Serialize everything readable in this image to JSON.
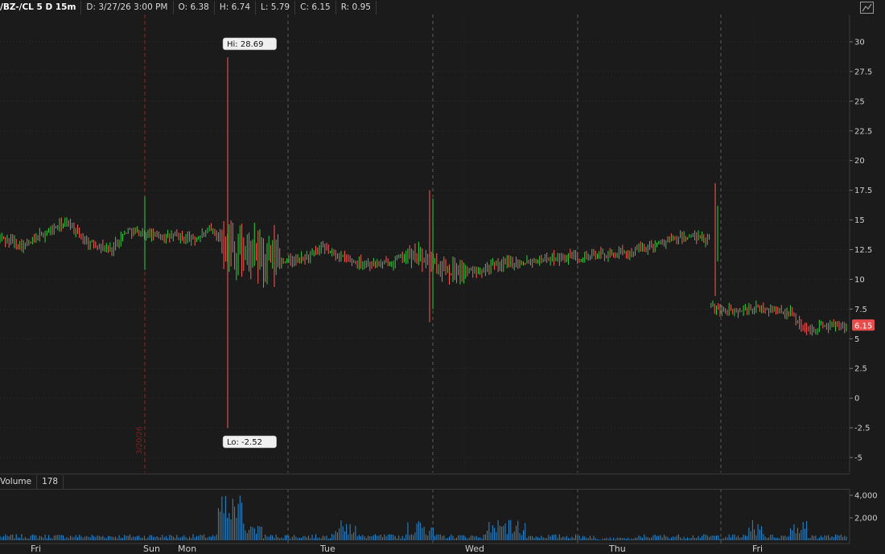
{
  "header": {
    "symbol": "/BZ-/CL 5 D 15m",
    "date": "D: 3/27/26 3:00 PM",
    "open": "O: 6.38",
    "high": "H: 6.74",
    "low": "L: 5.79",
    "close": "C: 6.15",
    "range": "R: 0.95"
  },
  "volume_header": {
    "label": "Volume",
    "value": "178"
  },
  "colors": {
    "up": "#2ecc40",
    "down": "#ff5a5a",
    "volume": "#2a8bd0",
    "background": "#1b1b1b",
    "separator": "#8a2020"
  },
  "icons": {
    "settings": "chart-settings-icon"
  },
  "chart_data": [
    {
      "type": "candlestick",
      "title": "/BZ-/CL 5 D 15m",
      "x_labels": [
        "Fri",
        "Sun",
        "Mon",
        "Tue",
        "Wed",
        "Thu",
        "Fri"
      ],
      "session_separator_label": "3/20/26",
      "y_ticks": [
        30,
        27.5,
        25,
        22.5,
        20,
        17.5,
        15,
        12.5,
        10,
        7.5,
        5,
        2.5,
        0,
        -2.5,
        -5
      ],
      "y_tick_labels": [
        "30",
        "27.5",
        "25",
        "22.5",
        "20",
        "17.5",
        "15",
        "12.5",
        "10",
        "7.5",
        "5",
        "2.5",
        "0",
        "-2.5",
        "-5"
      ],
      "ylim": [
        -6,
        32
      ],
      "last_price": 6.15,
      "last_price_label": "6.15",
      "hi_annotation": "Hi: 28.69",
      "lo_annotation": "Lo: -2.52",
      "hi_value": 28.69,
      "lo_value": -2.52,
      "approx_close_path": [
        [
          0,
          13.5
        ],
        [
          0.03,
          12.8
        ],
        [
          0.05,
          13.8
        ],
        [
          0.08,
          14.8
        ],
        [
          0.1,
          13.2
        ],
        [
          0.13,
          12.5
        ],
        [
          0.15,
          14.2
        ],
        [
          0.17,
          13.8
        ],
        [
          0.2,
          13.6
        ],
        [
          0.23,
          13.4
        ],
        [
          0.25,
          14.2
        ],
        [
          0.26,
          13.5
        ],
        [
          0.28,
          12.2
        ],
        [
          0.31,
          11.8
        ],
        [
          0.35,
          11.5
        ],
        [
          0.38,
          12.6
        ],
        [
          0.41,
          11.6
        ],
        [
          0.45,
          11.2
        ],
        [
          0.48,
          12.0
        ],
        [
          0.5,
          11.8
        ],
        [
          0.52,
          11.0
        ],
        [
          0.55,
          10.6
        ],
        [
          0.6,
          11.4
        ],
        [
          0.65,
          11.8
        ],
        [
          0.7,
          12.0
        ],
        [
          0.74,
          12.2
        ],
        [
          0.78,
          13.2
        ],
        [
          0.81,
          13.6
        ],
        [
          0.835,
          13.3
        ],
        [
          0.836,
          7.7
        ],
        [
          0.86,
          7.3
        ],
        [
          0.9,
          7.6
        ],
        [
          0.93,
          7.2
        ],
        [
          0.95,
          5.6
        ],
        [
          0.97,
          6.15
        ]
      ],
      "approx_candle_count": 470
    },
    {
      "type": "bar",
      "title": "Volume",
      "y_ticks": [
        4000,
        2000
      ],
      "y_tick_labels": [
        "4,000",
        "2,000"
      ],
      "ylim": [
        0,
        4400
      ],
      "approx_max": 4200,
      "approx_last": 178
    }
  ]
}
